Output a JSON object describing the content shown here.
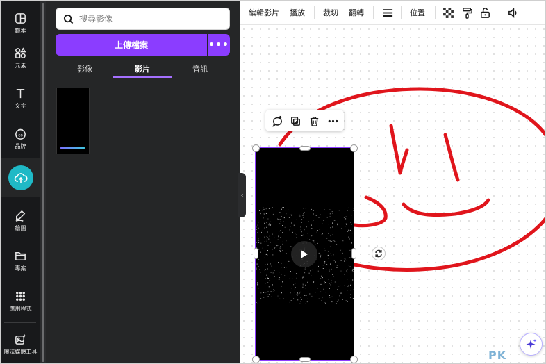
{
  "rail": {
    "items": [
      {
        "label": "範本",
        "icon": "layout-icon"
      },
      {
        "label": "元素",
        "icon": "shapes-icon"
      },
      {
        "label": "文字",
        "icon": "text-icon"
      },
      {
        "label": "品牌",
        "icon": "brand-icon"
      },
      {
        "label": "上傳",
        "icon": "cloud-upload-icon",
        "active": true
      },
      {
        "label": "繪圖",
        "icon": "draw-icon"
      },
      {
        "label": "專案",
        "icon": "folder-icon"
      },
      {
        "label": "應用程式",
        "icon": "apps-grid-icon"
      },
      {
        "label": "魔法媒體工具",
        "icon": "magic-media-icon"
      }
    ],
    "active_color": "#1fb9c6"
  },
  "panel": {
    "search_placeholder": "搜尋影像",
    "upload_button": "上傳檔案",
    "more_label": "•••",
    "tabs": [
      {
        "label": "影像"
      },
      {
        "label": "影片",
        "selected": true
      },
      {
        "label": "音訊"
      }
    ],
    "accent": "#8b3dff"
  },
  "toolbar": {
    "edit_video": "編輯影片",
    "play": "播放",
    "crop": "裁切",
    "flip": "翻轉",
    "position": "位置"
  },
  "canvas": {
    "stroke_color": "#e0151c",
    "selection_color": "#8b3dff"
  },
  "watermark": "PK"
}
